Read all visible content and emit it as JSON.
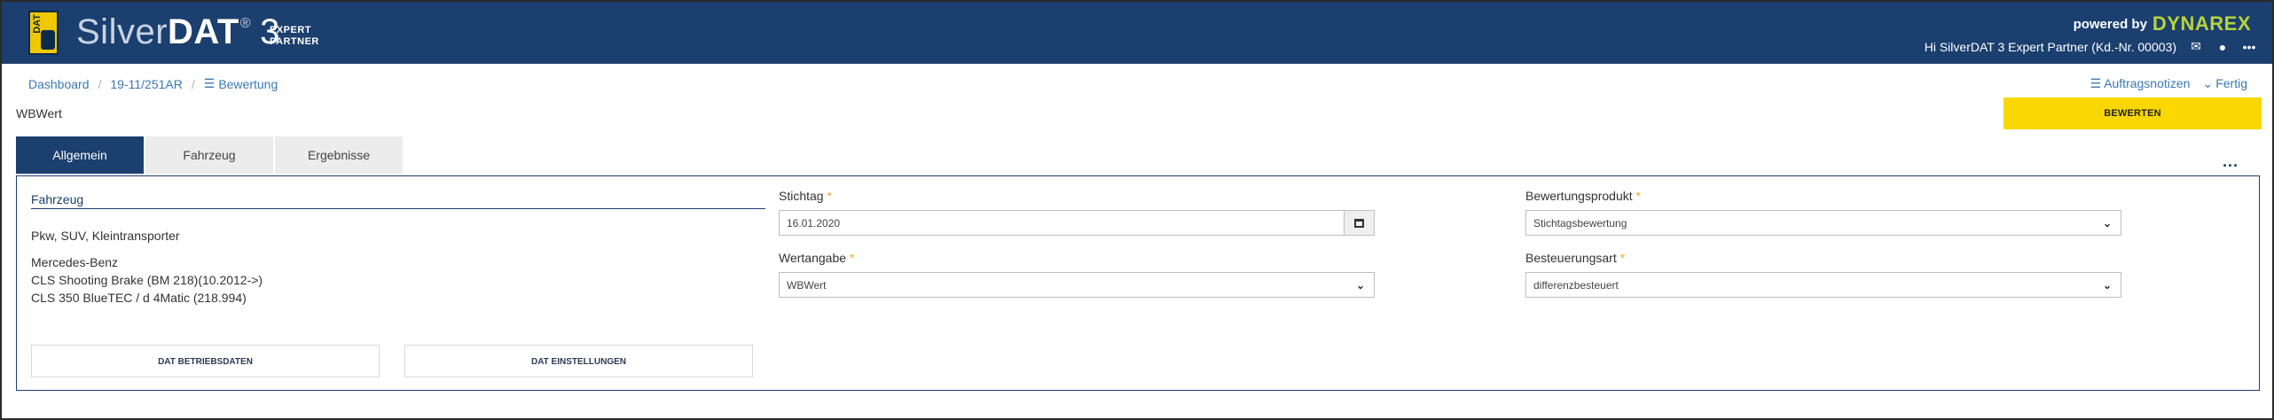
{
  "header": {
    "logo_badge": "DAT",
    "brand_light": "Silver",
    "brand_bold": "DAT",
    "brand_reg": "®",
    "brand_version": "3",
    "expert_line1": "EXPERT",
    "expert_line2": "PARTNER",
    "powered_by": "powered by",
    "partner_logo": "DYNAREX",
    "greeting": "Hi SilverDAT 3 Expert Partner (Kd.-Nr. 00003)",
    "icons": [
      "envelope-icon",
      "globe-icon",
      "more-icon"
    ]
  },
  "breadcrumb": {
    "items": [
      "Dashboard",
      "19-11/251AR",
      "Bewertung"
    ],
    "separator": "/"
  },
  "page_label": "WBWert",
  "actions": {
    "auftragsnotizen": "Auftragsnotizen",
    "fertig": "Fertig",
    "bewerten": "BEWERTEN"
  },
  "tabs": [
    "Allgemein",
    "Fahrzeug",
    "Ergebnisse"
  ],
  "more_menu": "...",
  "vehicle": {
    "section_title": "Fahrzeug",
    "type": "Pkw, SUV, Kleintransporter",
    "make": "Mercedes-Benz",
    "model": "CLS Shooting Brake (BM 218)(10.2012->)",
    "variant": "CLS 350 BlueTEC / d 4Matic (218.994)",
    "btn_betriebsdaten": "DAT BETRIEBSDATEN",
    "btn_einstellungen": "DAT EINSTELLUNGEN"
  },
  "form": {
    "stichtag": {
      "label": "Stichtag",
      "value": "16.01.2020"
    },
    "wertangabe": {
      "label": "Wertangabe",
      "value": "WBWert"
    },
    "bewertungsprodukt": {
      "label": "Bewertungsprodukt",
      "value": "Stichtagsbewertung"
    },
    "besteuerungsart": {
      "label": "Besteuerungsart",
      "value": "differenzbesteuert"
    },
    "required_marker": "*"
  },
  "colors": {
    "header_bg": "#1b3f6e",
    "accent_yellow": "#fad700",
    "link_blue": "#3a78b5",
    "required_orange": "#f5a623",
    "partner_green": "#b9d23c"
  }
}
